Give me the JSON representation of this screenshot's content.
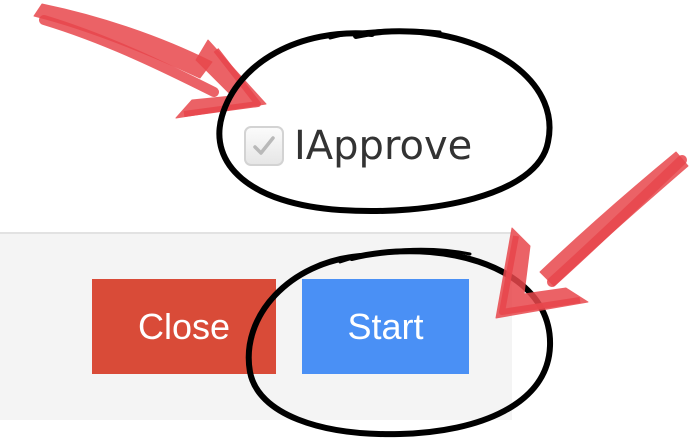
{
  "consent": {
    "checkbox_checked": true,
    "label": "IApprove"
  },
  "buttons": {
    "close_label": "Close",
    "start_label": "Start"
  },
  "colors": {
    "close_button": "#d94b38",
    "start_button": "#4a90f5",
    "annotation_arrow": "#e8474c",
    "annotation_circle": "#000000"
  },
  "icons": {
    "checkbox": "check-icon"
  }
}
